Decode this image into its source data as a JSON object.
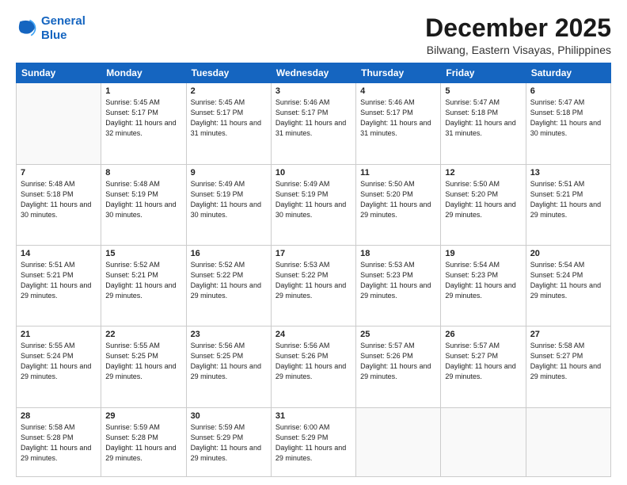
{
  "logo": {
    "line1": "General",
    "line2": "Blue"
  },
  "title": "December 2025",
  "location": "Bilwang, Eastern Visayas, Philippines",
  "days_header": [
    "Sunday",
    "Monday",
    "Tuesday",
    "Wednesday",
    "Thursday",
    "Friday",
    "Saturday"
  ],
  "weeks": [
    [
      {
        "num": "",
        "empty": true
      },
      {
        "num": "1",
        "sunrise": "Sunrise: 5:45 AM",
        "sunset": "Sunset: 5:17 PM",
        "daylight": "Daylight: 11 hours and 32 minutes."
      },
      {
        "num": "2",
        "sunrise": "Sunrise: 5:45 AM",
        "sunset": "Sunset: 5:17 PM",
        "daylight": "Daylight: 11 hours and 31 minutes."
      },
      {
        "num": "3",
        "sunrise": "Sunrise: 5:46 AM",
        "sunset": "Sunset: 5:17 PM",
        "daylight": "Daylight: 11 hours and 31 minutes."
      },
      {
        "num": "4",
        "sunrise": "Sunrise: 5:46 AM",
        "sunset": "Sunset: 5:17 PM",
        "daylight": "Daylight: 11 hours and 31 minutes."
      },
      {
        "num": "5",
        "sunrise": "Sunrise: 5:47 AM",
        "sunset": "Sunset: 5:18 PM",
        "daylight": "Daylight: 11 hours and 31 minutes."
      },
      {
        "num": "6",
        "sunrise": "Sunrise: 5:47 AM",
        "sunset": "Sunset: 5:18 PM",
        "daylight": "Daylight: 11 hours and 30 minutes."
      }
    ],
    [
      {
        "num": "7",
        "sunrise": "Sunrise: 5:48 AM",
        "sunset": "Sunset: 5:18 PM",
        "daylight": "Daylight: 11 hours and 30 minutes."
      },
      {
        "num": "8",
        "sunrise": "Sunrise: 5:48 AM",
        "sunset": "Sunset: 5:19 PM",
        "daylight": "Daylight: 11 hours and 30 minutes."
      },
      {
        "num": "9",
        "sunrise": "Sunrise: 5:49 AM",
        "sunset": "Sunset: 5:19 PM",
        "daylight": "Daylight: 11 hours and 30 minutes."
      },
      {
        "num": "10",
        "sunrise": "Sunrise: 5:49 AM",
        "sunset": "Sunset: 5:19 PM",
        "daylight": "Daylight: 11 hours and 30 minutes."
      },
      {
        "num": "11",
        "sunrise": "Sunrise: 5:50 AM",
        "sunset": "Sunset: 5:20 PM",
        "daylight": "Daylight: 11 hours and 29 minutes."
      },
      {
        "num": "12",
        "sunrise": "Sunrise: 5:50 AM",
        "sunset": "Sunset: 5:20 PM",
        "daylight": "Daylight: 11 hours and 29 minutes."
      },
      {
        "num": "13",
        "sunrise": "Sunrise: 5:51 AM",
        "sunset": "Sunset: 5:21 PM",
        "daylight": "Daylight: 11 hours and 29 minutes."
      }
    ],
    [
      {
        "num": "14",
        "sunrise": "Sunrise: 5:51 AM",
        "sunset": "Sunset: 5:21 PM",
        "daylight": "Daylight: 11 hours and 29 minutes."
      },
      {
        "num": "15",
        "sunrise": "Sunrise: 5:52 AM",
        "sunset": "Sunset: 5:21 PM",
        "daylight": "Daylight: 11 hours and 29 minutes."
      },
      {
        "num": "16",
        "sunrise": "Sunrise: 5:52 AM",
        "sunset": "Sunset: 5:22 PM",
        "daylight": "Daylight: 11 hours and 29 minutes."
      },
      {
        "num": "17",
        "sunrise": "Sunrise: 5:53 AM",
        "sunset": "Sunset: 5:22 PM",
        "daylight": "Daylight: 11 hours and 29 minutes."
      },
      {
        "num": "18",
        "sunrise": "Sunrise: 5:53 AM",
        "sunset": "Sunset: 5:23 PM",
        "daylight": "Daylight: 11 hours and 29 minutes."
      },
      {
        "num": "19",
        "sunrise": "Sunrise: 5:54 AM",
        "sunset": "Sunset: 5:23 PM",
        "daylight": "Daylight: 11 hours and 29 minutes."
      },
      {
        "num": "20",
        "sunrise": "Sunrise: 5:54 AM",
        "sunset": "Sunset: 5:24 PM",
        "daylight": "Daylight: 11 hours and 29 minutes."
      }
    ],
    [
      {
        "num": "21",
        "sunrise": "Sunrise: 5:55 AM",
        "sunset": "Sunset: 5:24 PM",
        "daylight": "Daylight: 11 hours and 29 minutes."
      },
      {
        "num": "22",
        "sunrise": "Sunrise: 5:55 AM",
        "sunset": "Sunset: 5:25 PM",
        "daylight": "Daylight: 11 hours and 29 minutes."
      },
      {
        "num": "23",
        "sunrise": "Sunrise: 5:56 AM",
        "sunset": "Sunset: 5:25 PM",
        "daylight": "Daylight: 11 hours and 29 minutes."
      },
      {
        "num": "24",
        "sunrise": "Sunrise: 5:56 AM",
        "sunset": "Sunset: 5:26 PM",
        "daylight": "Daylight: 11 hours and 29 minutes."
      },
      {
        "num": "25",
        "sunrise": "Sunrise: 5:57 AM",
        "sunset": "Sunset: 5:26 PM",
        "daylight": "Daylight: 11 hours and 29 minutes."
      },
      {
        "num": "26",
        "sunrise": "Sunrise: 5:57 AM",
        "sunset": "Sunset: 5:27 PM",
        "daylight": "Daylight: 11 hours and 29 minutes."
      },
      {
        "num": "27",
        "sunrise": "Sunrise: 5:58 AM",
        "sunset": "Sunset: 5:27 PM",
        "daylight": "Daylight: 11 hours and 29 minutes."
      }
    ],
    [
      {
        "num": "28",
        "sunrise": "Sunrise: 5:58 AM",
        "sunset": "Sunset: 5:28 PM",
        "daylight": "Daylight: 11 hours and 29 minutes."
      },
      {
        "num": "29",
        "sunrise": "Sunrise: 5:59 AM",
        "sunset": "Sunset: 5:28 PM",
        "daylight": "Daylight: 11 hours and 29 minutes."
      },
      {
        "num": "30",
        "sunrise": "Sunrise: 5:59 AM",
        "sunset": "Sunset: 5:29 PM",
        "daylight": "Daylight: 11 hours and 29 minutes."
      },
      {
        "num": "31",
        "sunrise": "Sunrise: 6:00 AM",
        "sunset": "Sunset: 5:29 PM",
        "daylight": "Daylight: 11 hours and 29 minutes."
      },
      {
        "num": "",
        "empty": true
      },
      {
        "num": "",
        "empty": true
      },
      {
        "num": "",
        "empty": true
      }
    ]
  ]
}
